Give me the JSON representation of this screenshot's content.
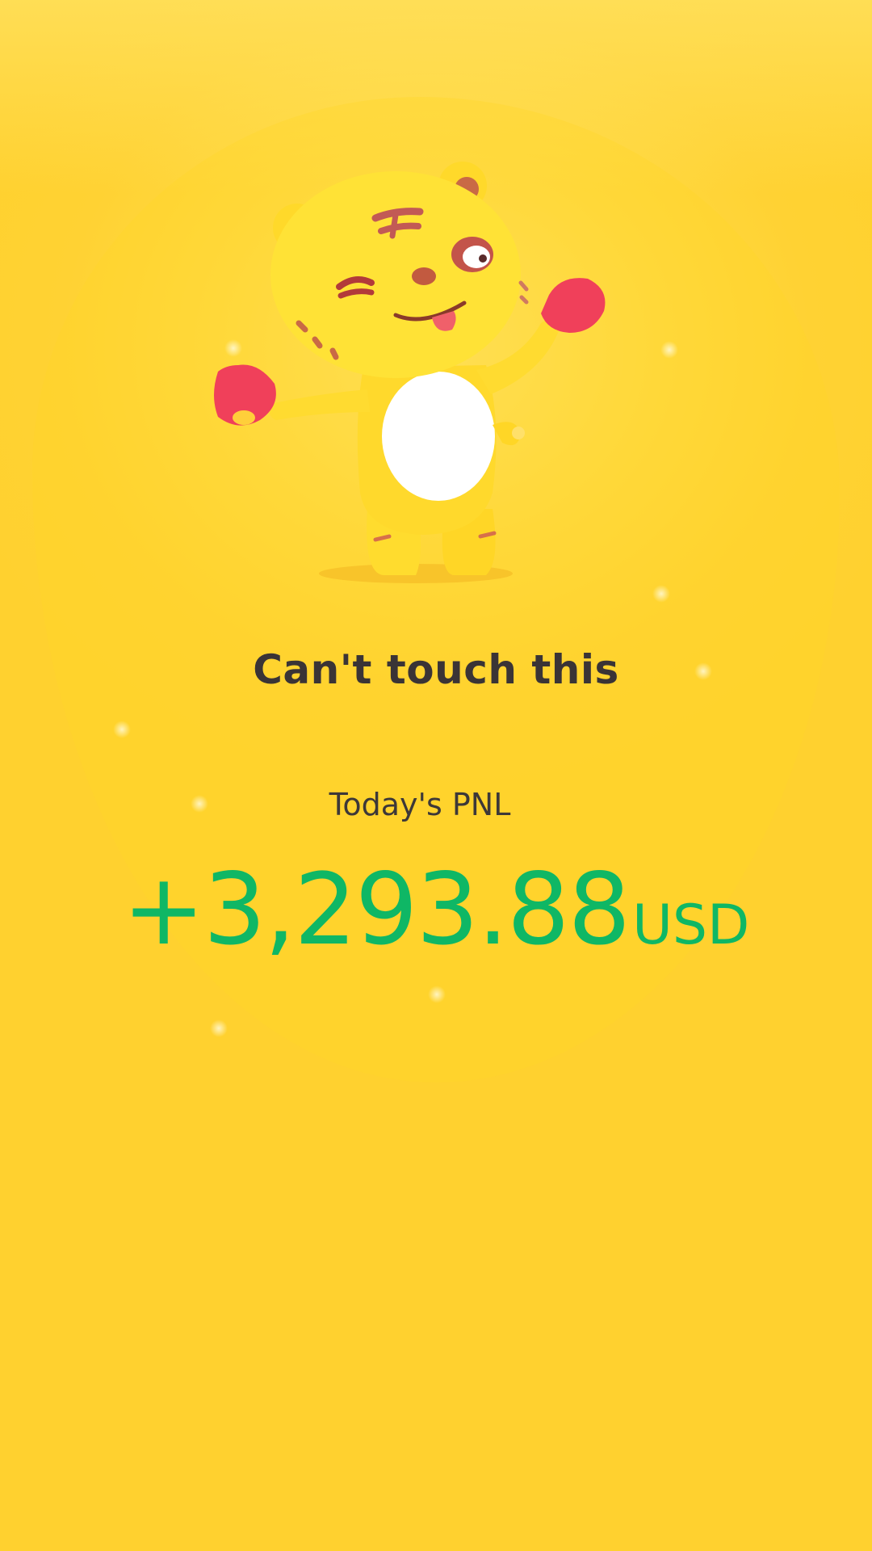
{
  "share_card": {
    "headline": "Can't touch this",
    "mascot_icon": "tiger-mascot-icon",
    "pnl": {
      "label": "Today's PNL",
      "amount": "+3,293.88",
      "currency": "USD",
      "direction": "profit"
    }
  },
  "colors": {
    "background": "#ffd233",
    "headline_text": "#3a3436",
    "profit_green": "#0fb765"
  }
}
